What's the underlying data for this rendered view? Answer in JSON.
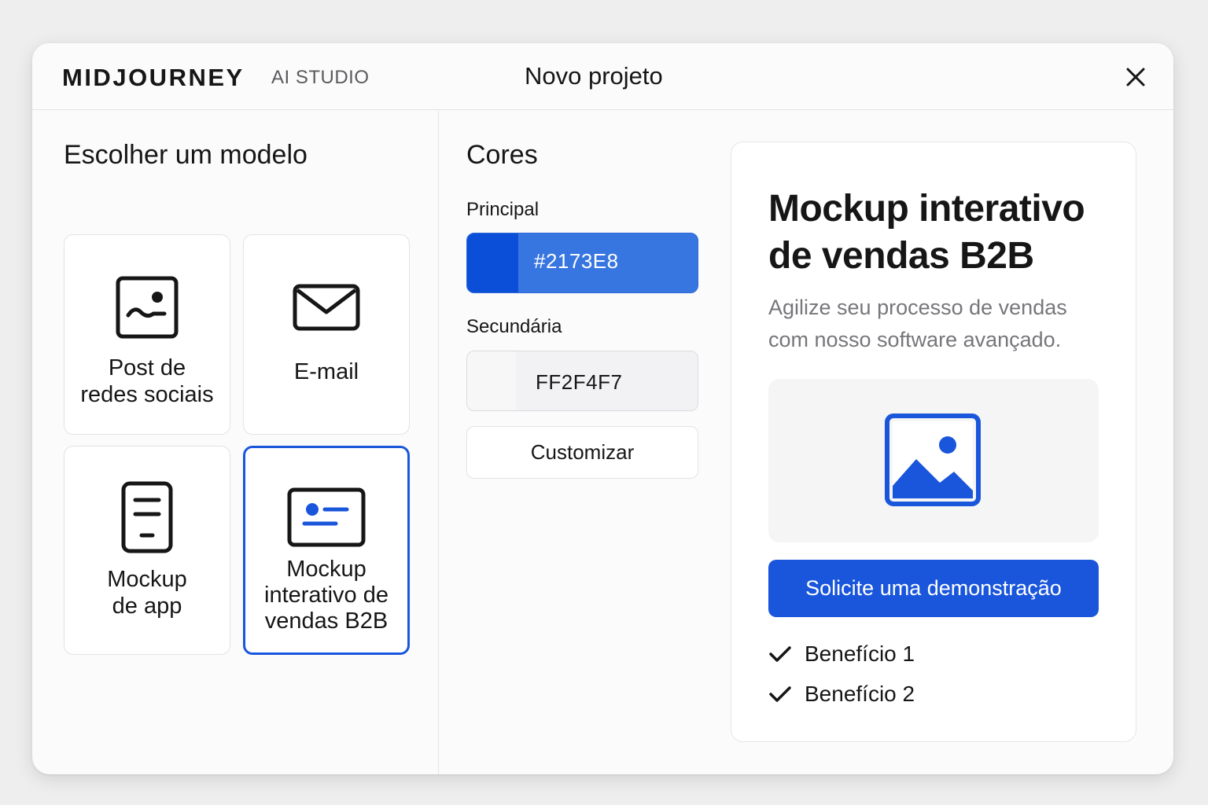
{
  "header": {
    "brand": "MIDJOURNEY",
    "brand_sub": "AI STUDIO",
    "title": "Novo projeto",
    "close_icon": "close-icon"
  },
  "templates": {
    "title": "Escolher um modelo",
    "items": [
      {
        "label_line1": "Post de",
        "label_line2": "redes sociais",
        "icon": "image-icon",
        "selected": false
      },
      {
        "label_line1": "E-mail",
        "label_line2": "",
        "icon": "mail-icon",
        "selected": false
      },
      {
        "label_line1": "Mockup",
        "label_line2": "de app",
        "icon": "phone-icon",
        "selected": false
      },
      {
        "label_line1": "Mockup",
        "label_line2": "interativo de",
        "label_line3": "vendas B2B",
        "icon": "id-card-icon",
        "selected": true
      }
    ]
  },
  "colors": {
    "title": "Cores",
    "primary_label": "Principal",
    "primary_value": "#2173E8",
    "secondary_label": "Secundária",
    "secondary_value": "FF2F4F7",
    "customize_label": "Customizar",
    "accent": "#1a56db"
  },
  "preview": {
    "title_line1": "Mockup interativo",
    "title_line2": "de vendas B2B",
    "subtitle_line1": "Agilize seu processo de vendas",
    "subtitle_line2": "com nosso software avançado.",
    "image_icon": "image-placeholder-icon",
    "cta_label": "Solicite uma demonstração",
    "benefits": [
      "Benefício 1",
      "Benefício 2"
    ]
  }
}
